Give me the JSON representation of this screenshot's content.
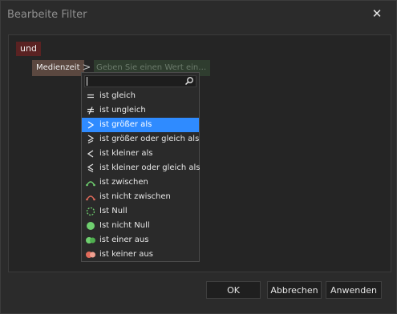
{
  "dialog": {
    "title": "Bearbeite Filter",
    "close_label": "✕"
  },
  "filter": {
    "group_label": "und",
    "field_label": "Medienzeit",
    "operator_symbol": ">",
    "value_placeholder": "Geben Sie einen Wert ein…"
  },
  "dropdown": {
    "items": [
      {
        "label": "ist gleich",
        "icon": "equals-icon"
      },
      {
        "label": "ist ungleich",
        "icon": "not-equal-icon"
      },
      {
        "label": "ist größer als",
        "icon": "greater-than-icon"
      },
      {
        "label": "ist größer oder gleich als",
        "icon": "greater-or-equal-icon"
      },
      {
        "label": "ist kleiner als",
        "icon": "less-than-icon"
      },
      {
        "label": "ist kleiner oder gleich als",
        "icon": "less-or-equal-icon"
      },
      {
        "label": "ist zwischen",
        "icon": "between-icon"
      },
      {
        "label": "ist nicht zwischen",
        "icon": "not-between-icon"
      },
      {
        "label": "Ist Null",
        "icon": "is-null-icon"
      },
      {
        "label": "Ist nicht Null",
        "icon": "is-not-null-icon"
      },
      {
        "label": "ist einer aus",
        "icon": "is-any-of-icon"
      },
      {
        "label": "ist keiner aus",
        "icon": "is-none-of-icon"
      }
    ],
    "selected_index": 2
  },
  "buttons": {
    "ok": "OK",
    "cancel": "Abbrechen",
    "apply": "Anwenden"
  },
  "colors": {
    "accent": "#2f8bff",
    "group_bg": "#5a2222",
    "field_bg": "#5b4840",
    "value_bg": "#2f3d2f"
  }
}
